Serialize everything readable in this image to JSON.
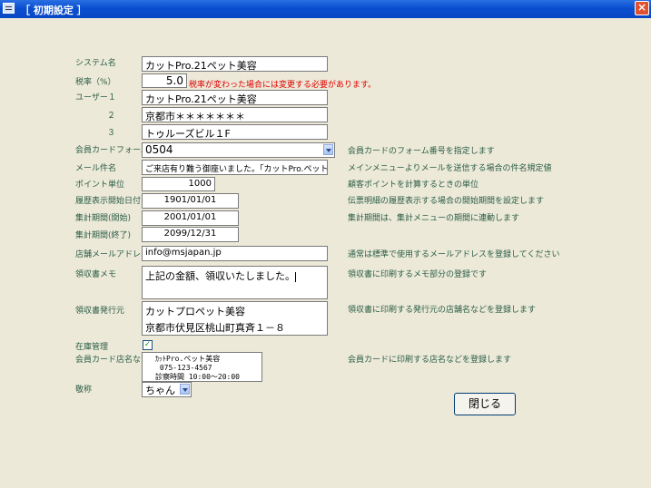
{
  "window": {
    "title": "［ 初期設定 ］",
    "close_icon": "×"
  },
  "fields": {
    "system_name": {
      "label": "システム名",
      "value": "カットPro.21ペット美容"
    },
    "tax_rate": {
      "label": "税率（%）",
      "value": "5.0",
      "warning": "税率が変わった場合には変更する必要があります。"
    },
    "user1": {
      "label": "ユーザー１",
      "value": "カットPro.21ペット美容"
    },
    "user2": {
      "label": "２",
      "value": "京都市＊＊＊＊＊＊＊"
    },
    "user3": {
      "label": "３",
      "value": "トゥルーズビル１F"
    },
    "member_card_form": {
      "label": "会員カードフォーム",
      "value": "0504",
      "help": "会員カードのフォーム番号を指定します"
    },
    "mail_subject": {
      "label": "メール件名",
      "value": "ご来店有り難う御座いました。「カットPro.ペット美容」",
      "help": "メインメニューよりメールを送信する場合の件名規定値"
    },
    "point_unit": {
      "label": "ポイント単位",
      "value": "1000",
      "help": "顧客ポイントを計算するときの単位"
    },
    "history_start": {
      "label": "履歴表示開始日付",
      "value": "1901/01/01",
      "help": "伝票明細の履歴表示する場合の開始期間を設定します"
    },
    "period_start": {
      "label": "集計期間(開始)",
      "value": "2001/01/01",
      "help": "集計期間は、集計メニューの期間に連動します"
    },
    "period_end": {
      "label": "集計期間(終了)",
      "value": "2099/12/31"
    },
    "shop_email": {
      "label": "店舗メールアドレス",
      "value": "info@msjapan.jp",
      "help": "通常は標準で使用するメールアドレスを登録してください"
    },
    "receipt_memo": {
      "label": "領収書メモ",
      "value": "上記の金額、領収いたしました。",
      "help": "領収書に印刷するメモ部分の登録です"
    },
    "receipt_issuer": {
      "label": "領収書発行元",
      "line1": "カットプロペット美容",
      "line2": "京都市伏見区桃山町真斉１－８",
      "help": "領収書に印刷する発行元の店舗名などを登録します"
    },
    "stock_mgmt": {
      "label": "在庫管理",
      "checked": true
    },
    "member_card_shop": {
      "label": "会員カード店名など",
      "value": "ｶｯﾄPro.ペット美容\n 075-123-4567\n診察時間 10:00～20:00",
      "help": "会員カードに印刷する店名などを登録します"
    },
    "honorific": {
      "label": "敬称",
      "value": "ちゃん"
    }
  },
  "buttons": {
    "close": "閉じる"
  }
}
